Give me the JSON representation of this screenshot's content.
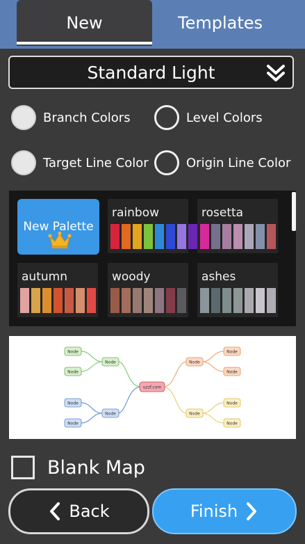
{
  "tabs": [
    {
      "label": "New"
    },
    {
      "label": "Templates"
    }
  ],
  "theme_select": {
    "value": "Standard Light"
  },
  "options": {
    "branch_colors": "Branch Colors",
    "level_colors": "Level Colors",
    "target_line_color": "Target Line Color",
    "origin_line_color": "Origin Line Color"
  },
  "palettes": {
    "new_palette": "New Palette",
    "items": [
      {
        "name": "rainbow",
        "colors": [
          "#d8243a",
          "#e16a1f",
          "#e3a51c",
          "#7cc23c",
          "#2f89d9",
          "#2e49d5",
          "#9677df",
          "#6a26b5"
        ]
      },
      {
        "name": "rosetta",
        "colors": [
          "#d72a9a",
          "#76708d",
          "#a67fa0",
          "#b98eae",
          "#a9a7b8",
          "#8590aa",
          "#b5565a"
        ]
      },
      {
        "name": "autumn",
        "colors": [
          "#e2a2a0",
          "#d7a44c",
          "#dd8f2f",
          "#d4532f",
          "#c85a45",
          "#d78e6a",
          "#e14a44"
        ]
      },
      {
        "name": "woody",
        "colors": [
          "#9a5a48",
          "#a26d5b",
          "#977a6f",
          "#a0857a",
          "#8f7483",
          "#833c48",
          "#5b5a5f"
        ]
      },
      {
        "name": "ashes",
        "colors": [
          "#8a969c",
          "#5c696f",
          "#7f8d8c",
          "#8f9796",
          "#aba9b0",
          "#c8c6cc",
          "#b0acb4"
        ]
      }
    ]
  },
  "preview": {
    "center": "uzzf.com",
    "node": "Node"
  },
  "blank_map": {
    "label": "Blank Map"
  },
  "buttons": {
    "back": "Back",
    "finish": "Finish"
  }
}
